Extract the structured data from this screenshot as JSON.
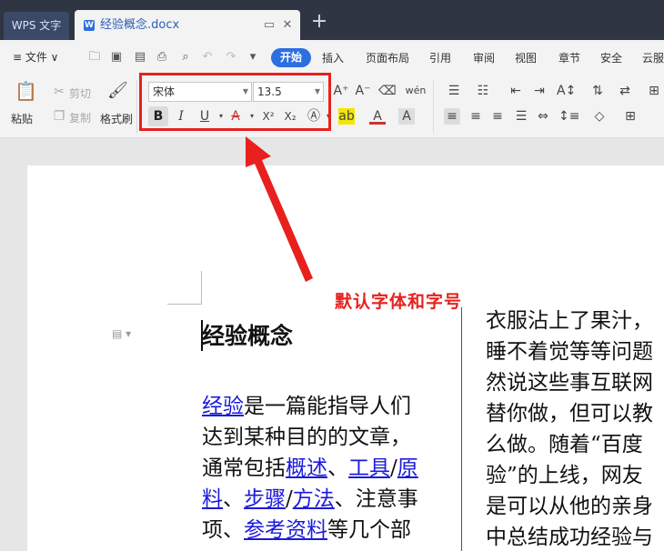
{
  "tabs": {
    "app_label": "WPS 文字",
    "doc_title": "经验概念.docx",
    "doc_icon_letter": "W",
    "new_tab_symbol": "+"
  },
  "menubar": {
    "file_label": "≡ 文件 ∨",
    "items": [
      "开始",
      "插入",
      "页面布局",
      "引用",
      "审阅",
      "视图",
      "章节",
      "安全",
      "云服"
    ]
  },
  "ribbon": {
    "paste_label": "粘贴",
    "cut_label": "剪切",
    "copy_label": "复制",
    "format_painter_label": "格式刷",
    "font_name": "宋体",
    "font_size": "13.5",
    "bold_label": "B",
    "italic_label": "I",
    "underline_label": "U",
    "strike_label": "A",
    "superscript_label": "X²",
    "subscript_label": "X₂"
  },
  "annotation": {
    "text": "默认字体和字号",
    "color": "#e8201e"
  },
  "document": {
    "heading": "经验概念",
    "left_column": [
      [
        {
          "t": "经验",
          "link": true
        },
        {
          "t": "是一篇能指导人们"
        }
      ],
      [
        {
          "t": "达到某种目的的文章，"
        }
      ],
      [
        {
          "t": "通常包括"
        },
        {
          "t": "概述",
          "link": true
        },
        {
          "t": "、"
        },
        {
          "t": "工具",
          "link": true
        },
        {
          "t": "/"
        },
        {
          "t": "原",
          "link": true
        }
      ],
      [
        {
          "t": "料",
          "link": true
        },
        {
          "t": "、"
        },
        {
          "t": "步骤",
          "link": true
        },
        {
          "t": "/"
        },
        {
          "t": "方法",
          "link": true
        },
        {
          "t": "、注意事"
        }
      ],
      [
        {
          "t": "项、"
        },
        {
          "t": "参考资料",
          "link": true
        },
        {
          "t": "等几个部"
        }
      ]
    ],
    "right_column": [
      "衣服沾上了果汁，",
      "睡不着觉等等问题",
      "然说这些事互联网",
      "替你做，但可以教",
      "么做。随着“百度",
      "验”的上线，网友",
      "是可以从他的亲身",
      "中总结成功经验与"
    ]
  },
  "colors": {
    "accent": "#2e6fe0",
    "link": "#1a1adb",
    "highlight": "#e8201e"
  }
}
